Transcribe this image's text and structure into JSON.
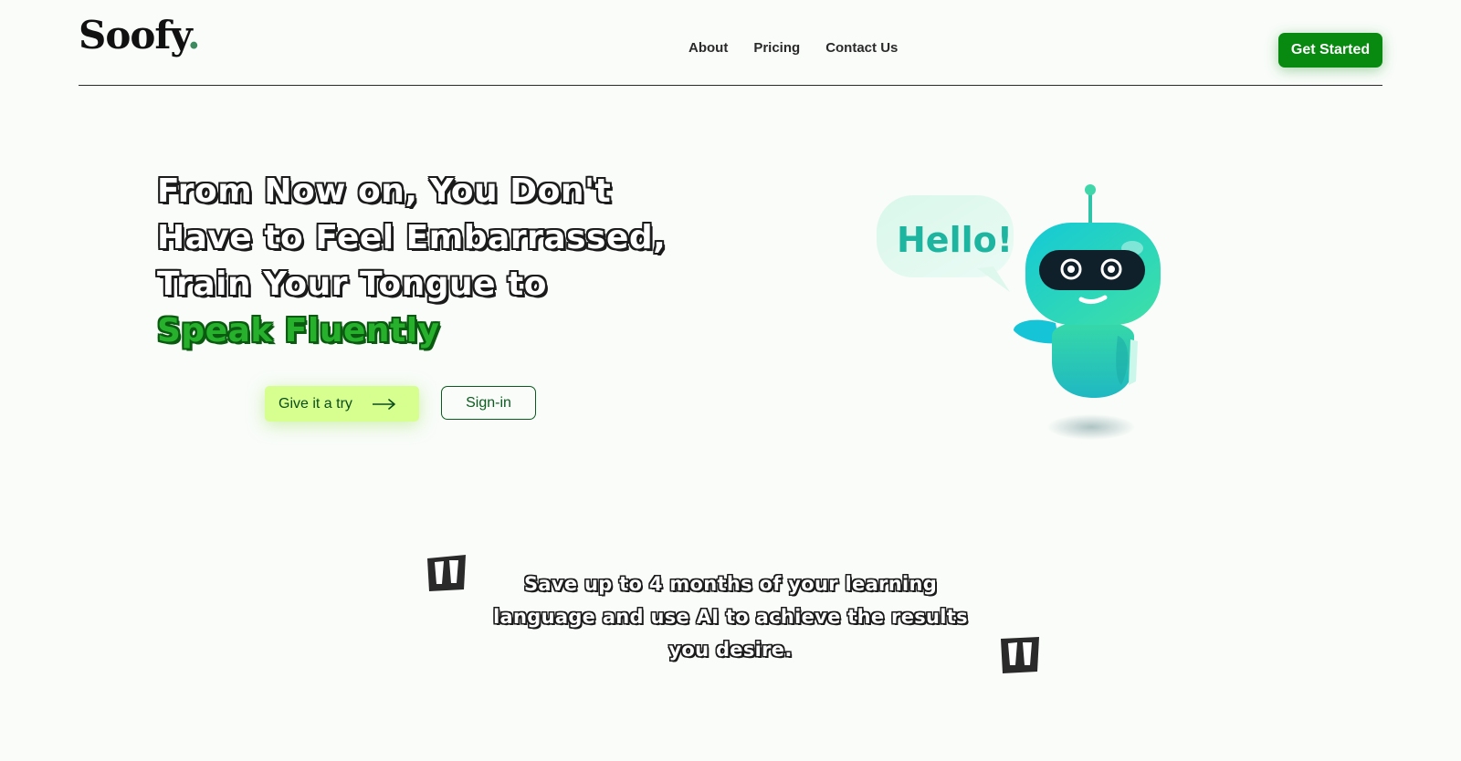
{
  "brand": {
    "name": "Soofy",
    "dot": "."
  },
  "nav": {
    "items": [
      "About",
      "Pricing",
      "Contact Us"
    ]
  },
  "header": {
    "cta_label": "Get Started"
  },
  "hero": {
    "title_plain": "From Now on, You Don't Have to Feel Embarrassed, Train Your Tongue to ",
    "title_accent": "Speak Fluently",
    "primary_button": "Give it a try",
    "secondary_button": "Sign-in"
  },
  "illustration": {
    "bubble_text": "Hello!"
  },
  "quote": {
    "text": "Save up to 4 months of your learning language and use AI to achieve the results you desire."
  },
  "colors": {
    "brand_green": "#078a0f",
    "accent_green": "#26b02c",
    "try_button_bg": "#d6ff8f",
    "robot_teal": "#2ad3b3",
    "background": "#f9fcf9"
  },
  "icons": [
    "arrow-right-icon",
    "robot-illustration",
    "open-quote-icon",
    "close-quote-icon"
  ]
}
